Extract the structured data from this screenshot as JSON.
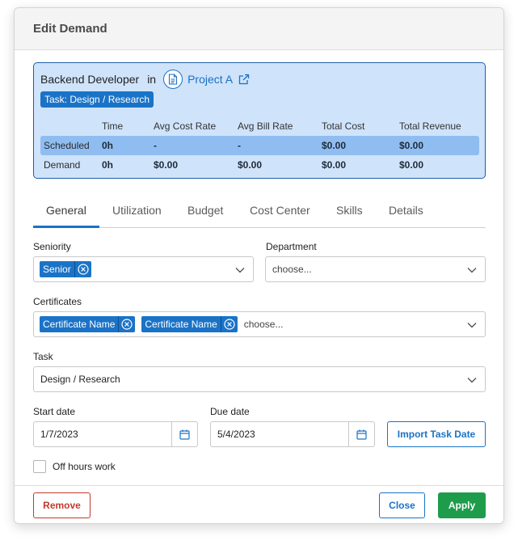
{
  "modal": {
    "title": "Edit Demand"
  },
  "summary": {
    "role": "Backend Developer",
    "in_word": "in",
    "project": "Project A",
    "task_badge": "Task: Design / Research",
    "columns": [
      "",
      "Time",
      "Avg Cost Rate",
      "Avg Bill Rate",
      "Total Cost",
      "Total Revenue"
    ],
    "rows": [
      {
        "label": "Scheduled",
        "time": "0h",
        "avg_cost_rate": "-",
        "avg_bill_rate": "-",
        "total_cost": "$0.00",
        "total_revenue": "$0.00"
      },
      {
        "label": "Demand",
        "time": "0h",
        "avg_cost_rate": "$0.00",
        "avg_bill_rate": "$0.00",
        "total_cost": "$0.00",
        "total_revenue": "$0.00"
      }
    ]
  },
  "tabs": [
    "General",
    "Utilization",
    "Budget",
    "Cost Center",
    "Skills",
    "Details"
  ],
  "form": {
    "seniority": {
      "label": "Seniority",
      "chips": [
        "Senior"
      ]
    },
    "department": {
      "label": "Department",
      "placeholder": "choose..."
    },
    "certificates": {
      "label": "Certificates",
      "chips": [
        "Certificate Name",
        "Certificate Name"
      ],
      "placeholder": "choose..."
    },
    "task": {
      "label": "Task",
      "value": "Design / Research"
    },
    "start_date": {
      "label": "Start date",
      "value": "1/7/2023"
    },
    "due_date": {
      "label": "Due date",
      "value": "5/4/2023"
    },
    "import_button": "Import Task Date",
    "off_hours": {
      "label": "Off hours work",
      "checked": false
    }
  },
  "footer": {
    "remove": "Remove",
    "close": "Close",
    "apply": "Apply"
  },
  "colors": {
    "accent": "#1a73c7",
    "danger": "#c33a2c",
    "success": "#1e9c4b",
    "summary_bg": "#cfe3fb",
    "highlight_row": "#8fbdf1"
  }
}
